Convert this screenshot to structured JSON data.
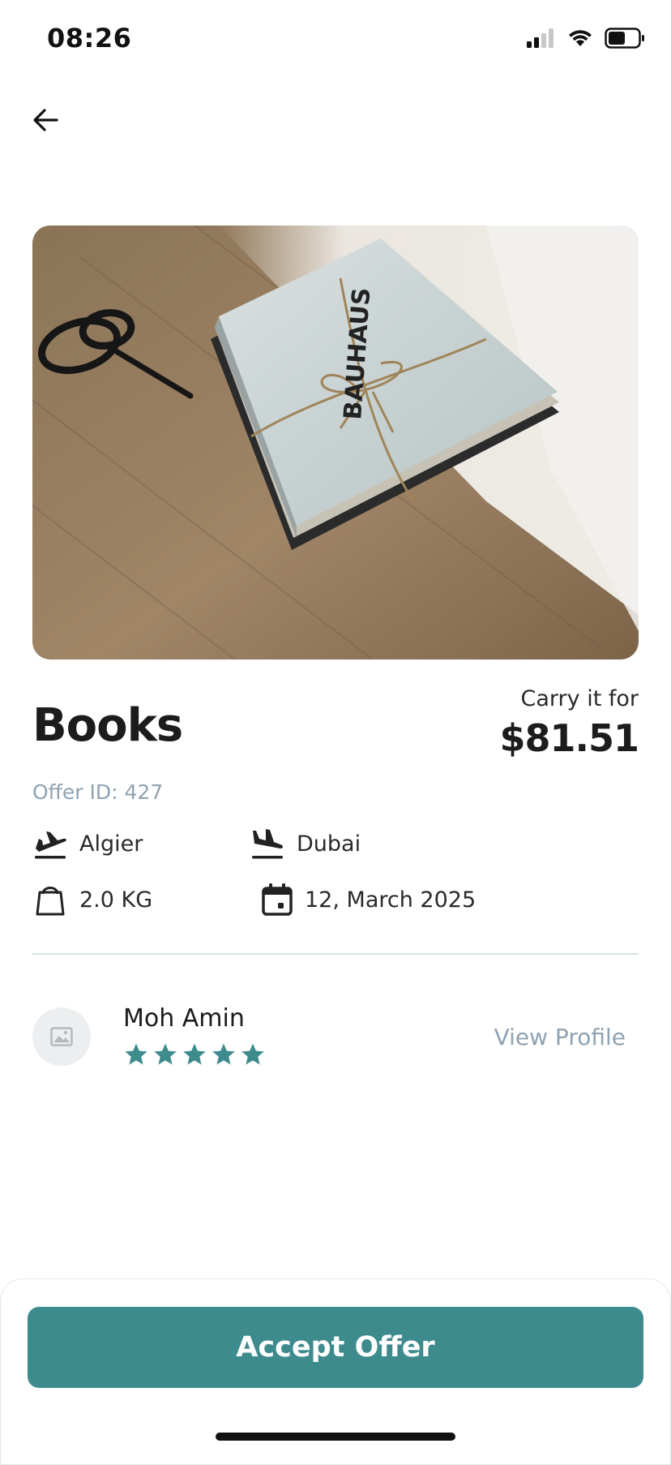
{
  "status_bar": {
    "time": "08:26"
  },
  "offer": {
    "title": "Books",
    "carry_label": "Carry it for",
    "price": "$81.51",
    "offer_id": "Offer ID: 427",
    "from": "Algier",
    "to": "Dubai",
    "weight": "2.0 KG",
    "date": "12, March 2025"
  },
  "user": {
    "name": "Moh Amin",
    "rating": 5,
    "view_profile_label": "View Profile"
  },
  "actions": {
    "accept_label": "Accept Offer"
  },
  "colors": {
    "accent": "#3e8b8e",
    "muted": "#8fa3b3"
  },
  "icons": [
    "back-arrow-icon",
    "takeoff-icon",
    "landing-icon",
    "bag-icon",
    "calendar-icon",
    "image-placeholder-icon",
    "star-icon",
    "signal-icon",
    "wifi-icon",
    "battery-icon"
  ]
}
